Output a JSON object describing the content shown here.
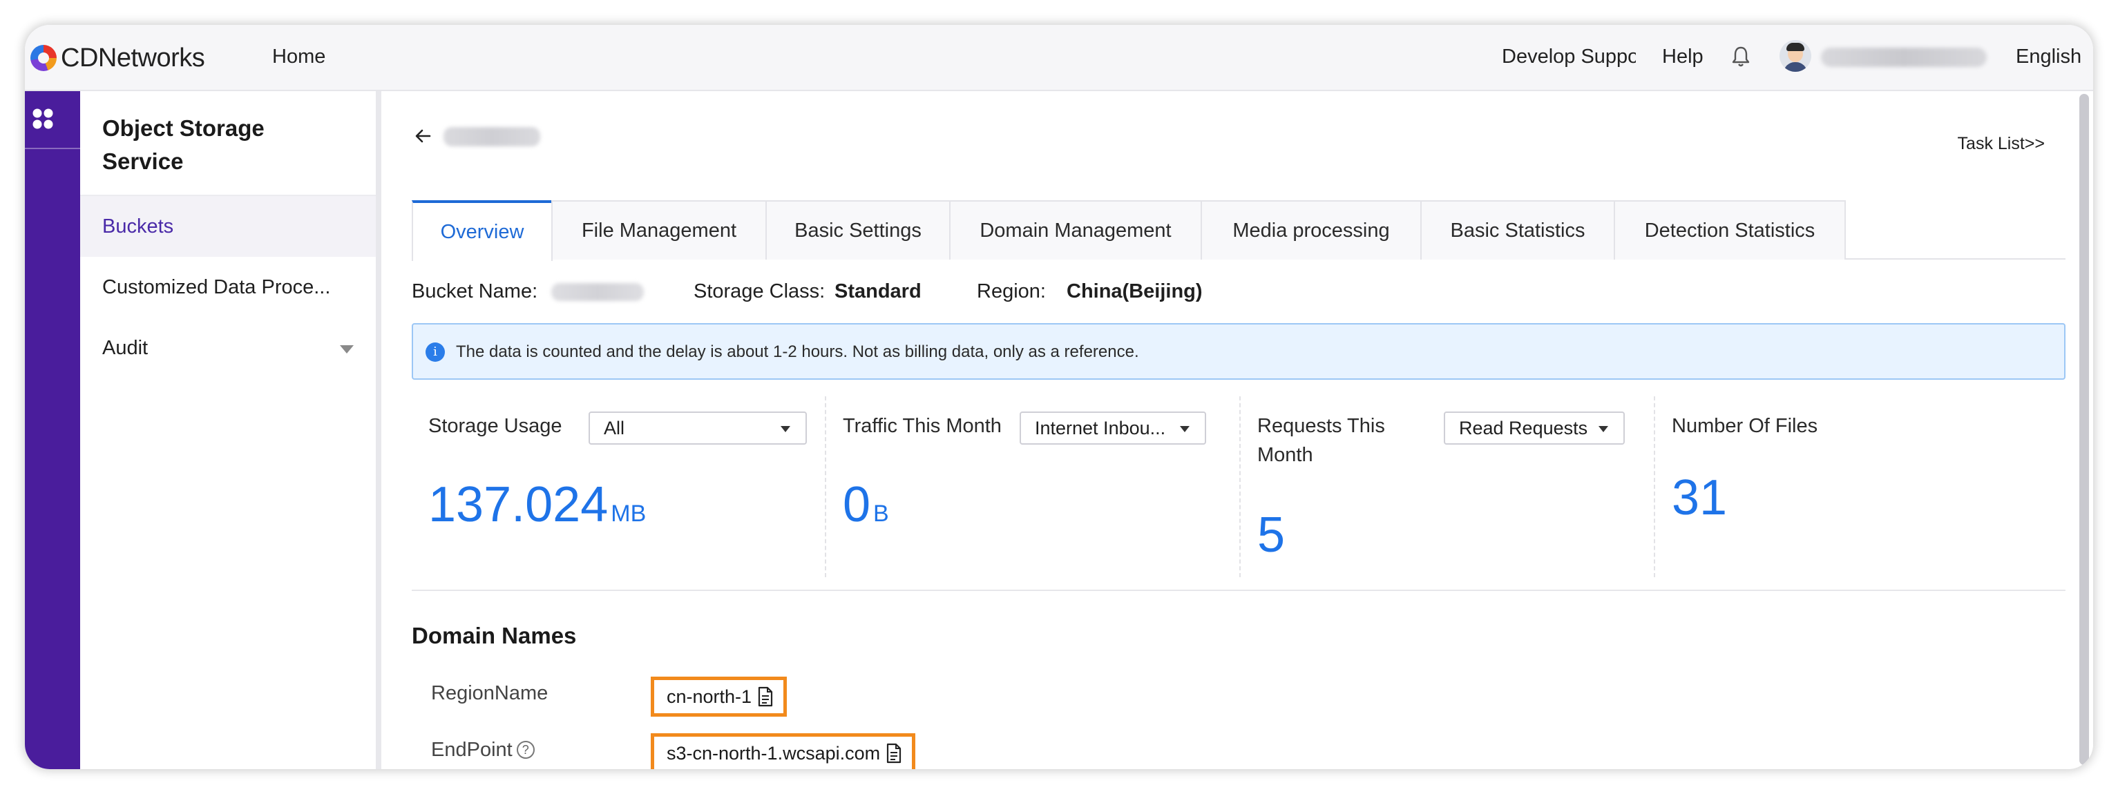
{
  "app": {
    "brand": "CDNetworks",
    "nav_home": "Home",
    "develop_support": "Develop Support",
    "help": "Help",
    "language": "English"
  },
  "sidebar": {
    "title": "Object Storage Service",
    "items": [
      {
        "label": "Buckets",
        "active": true
      },
      {
        "label": "Customized Data Proce..."
      },
      {
        "label": "Audit"
      }
    ]
  },
  "header": {
    "task_list": "Task List>>"
  },
  "tabs": [
    {
      "label": "Overview",
      "active": true
    },
    {
      "label": "File Management"
    },
    {
      "label": "Basic Settings"
    },
    {
      "label": "Domain Management"
    },
    {
      "label": "Media processing"
    },
    {
      "label": "Basic Statistics"
    },
    {
      "label": "Detection Statistics"
    }
  ],
  "bucket_info": {
    "bucket_name_label": "Bucket Name:",
    "storage_class_label": "Storage Class:",
    "storage_class_value": "Standard",
    "region_label": "Region:",
    "region_value": "China(Beijing)"
  },
  "notice": {
    "icon": "info-icon",
    "text": "The data is counted and the delay is about 1-2 hours. Not as billing data, only as a reference."
  },
  "stats": {
    "storage_usage": {
      "label": "Storage Usage",
      "select": "All",
      "value": "137.024",
      "unit": "MB"
    },
    "traffic": {
      "label": "Traffic This Month",
      "select": "Internet Inbou...",
      "value": "0",
      "unit": "B"
    },
    "requests": {
      "label": "Requests This Month",
      "select": "Read Requests",
      "value": "5"
    },
    "files": {
      "label": "Number Of Files",
      "value": "31"
    }
  },
  "domain_names": {
    "title": "Domain Names",
    "region_name_label": "RegionName",
    "region_name_value": "cn-north-1",
    "endpoint_label": "EndPoint",
    "endpoint_value": "s3-cn-north-1.wcsapi.com"
  },
  "colors": {
    "accent": "#1e73e8",
    "rail": "#4a1d9c",
    "highlight_border": "#f28a1c",
    "notice_bg": "#e8f3ff"
  }
}
